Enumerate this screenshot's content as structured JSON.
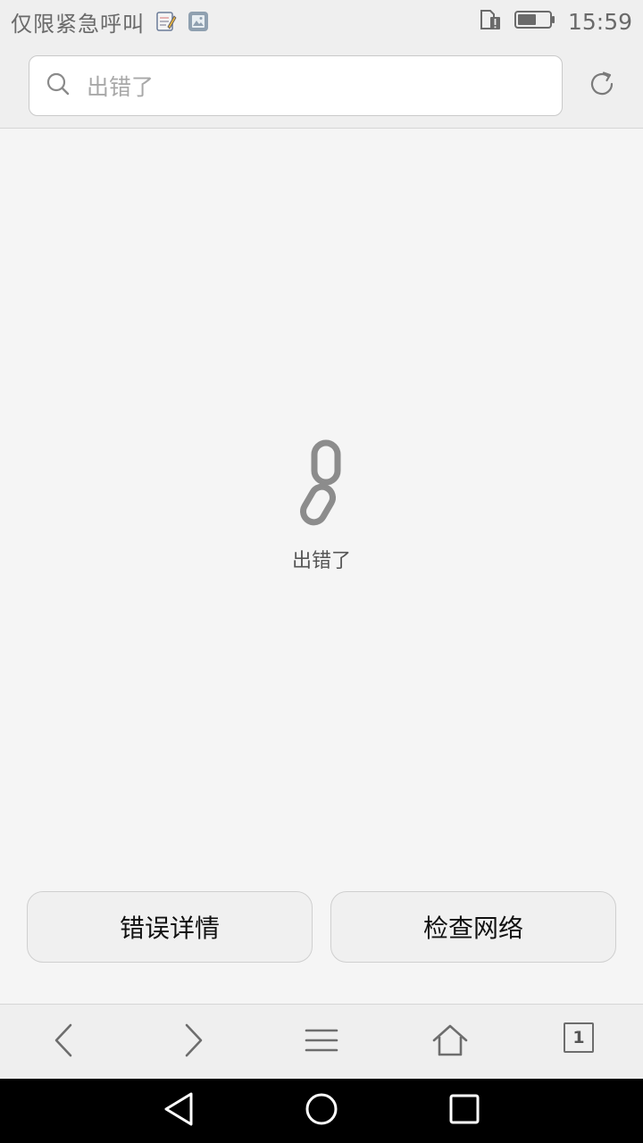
{
  "status_bar": {
    "carrier": "仅限紧急呼叫",
    "time": "15:59",
    "notification_icons": [
      "notes-icon",
      "image-icon"
    ],
    "system_icons": [
      "sim-alert-icon",
      "battery-icon"
    ],
    "battery_level": 0.6
  },
  "address_bar": {
    "search_text": "出错了",
    "refresh_icon": "refresh-icon"
  },
  "error": {
    "icon": "broken-link-icon",
    "message": "出错了"
  },
  "buttons": {
    "details_label": "错误详情",
    "network_label": "检查网络"
  },
  "toolbar": {
    "back_icon": "chevron-left-icon",
    "forward_icon": "chevron-right-icon",
    "menu_icon": "menu-icon",
    "home_icon": "home-icon",
    "tabs_count": "1"
  },
  "navbar": {
    "icons": [
      "back-triangle-icon",
      "home-circle-icon",
      "recents-square-icon"
    ]
  },
  "colors": {
    "status_bg": "#efefef",
    "page_bg": "#f5f5f5",
    "icon_gray": "#6d6d6d",
    "nav_bg": "#000000"
  }
}
